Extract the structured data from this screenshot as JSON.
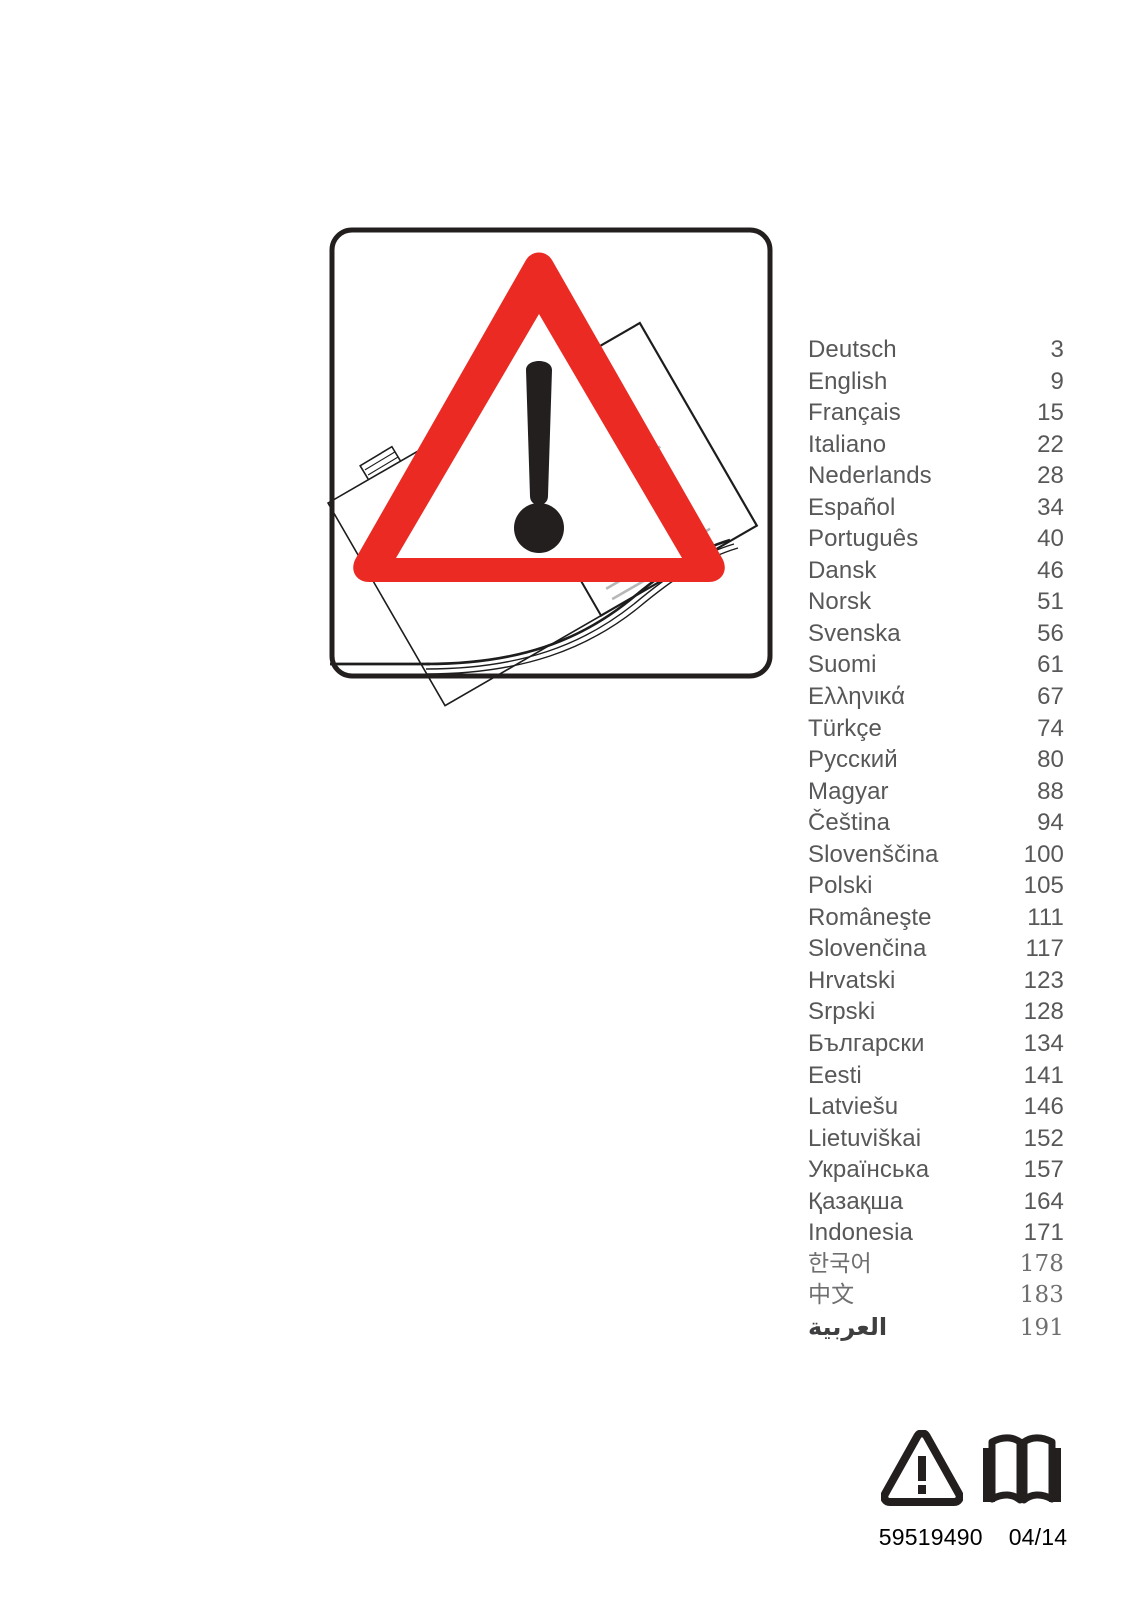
{
  "document": {
    "illustration": {
      "alt_name": "warning-triangle-over-manual",
      "triangle_color": "#ea2a23",
      "exclamation_color": "#231f1f",
      "frame_color": "#231f1f"
    },
    "languages": [
      {
        "name": "Deutsch",
        "page": "3"
      },
      {
        "name": "English",
        "page": "9"
      },
      {
        "name": "Français",
        "page": "15"
      },
      {
        "name": "Italiano",
        "page": "22"
      },
      {
        "name": "Nederlands",
        "page": "28"
      },
      {
        "name": "Español",
        "page": "34"
      },
      {
        "name": "Português",
        "page": "40"
      },
      {
        "name": "Dansk",
        "page": "46"
      },
      {
        "name": "Norsk",
        "page": "51"
      },
      {
        "name": "Svenska",
        "page": "56"
      },
      {
        "name": "Suomi",
        "page": "61"
      },
      {
        "name": "Ελληνικά",
        "page": "67"
      },
      {
        "name": "Türkçe",
        "page": "74"
      },
      {
        "name": "Русский",
        "page": "80"
      },
      {
        "name": "Magyar",
        "page": "88"
      },
      {
        "name": "Čeština",
        "page": "94"
      },
      {
        "name": "Slovenščina",
        "page": "100"
      },
      {
        "name": "Polski",
        "page": "105"
      },
      {
        "name": "Româneşte",
        "page": "111"
      },
      {
        "name": "Slovenčina",
        "page": "117"
      },
      {
        "name": "Hrvatski",
        "page": "123"
      },
      {
        "name": "Srpski",
        "page": "128"
      },
      {
        "name": "Български",
        "page": "134"
      },
      {
        "name": "Eesti",
        "page": "141"
      },
      {
        "name": "Latviešu",
        "page": "146"
      },
      {
        "name": "Lietuviškai",
        "page": "152"
      },
      {
        "name": "Українська",
        "page": "157"
      },
      {
        "name": "Қазақша",
        "page": "164"
      },
      {
        "name": "Indonesia",
        "page": "171"
      },
      {
        "name": "한국어",
        "page": "178",
        "script": "cjk"
      },
      {
        "name": "中文",
        "page": "183",
        "script": "cjk"
      },
      {
        "name": "العربية",
        "page": "191",
        "script": "rtl"
      }
    ],
    "footer": {
      "icons": [
        "warning-triangle-icon",
        "read-manual-book-icon"
      ],
      "part_number": "59519490",
      "date_code": "04/14"
    }
  }
}
